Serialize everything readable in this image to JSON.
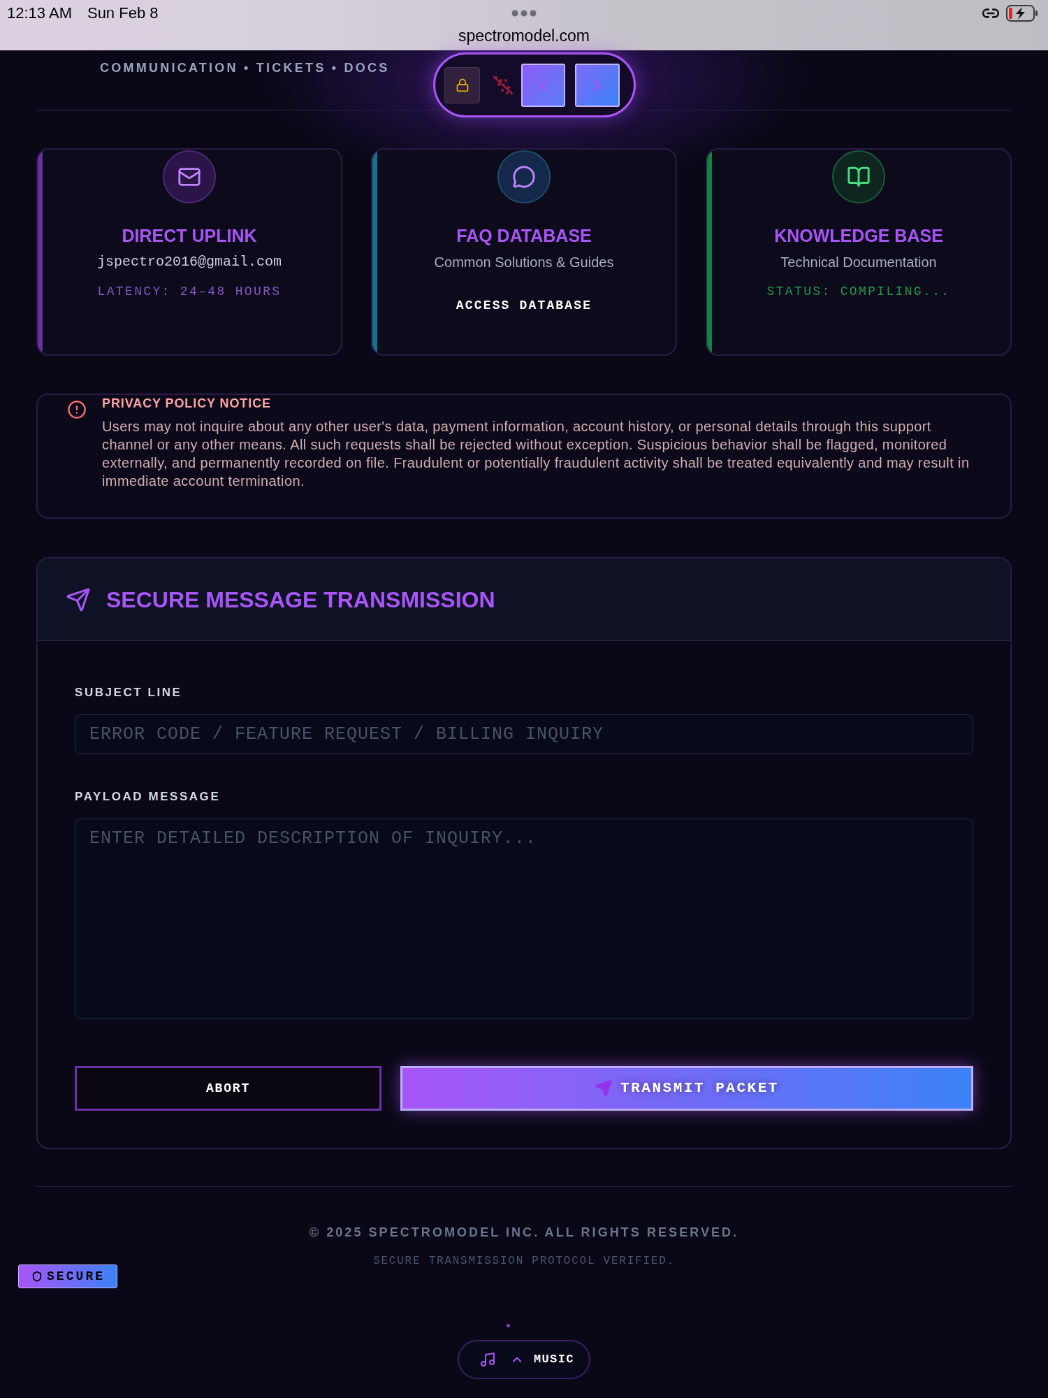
{
  "status_bar": {
    "time": "12:13 AM",
    "date": "Sun Feb 8",
    "url": "spectromodel.com"
  },
  "header": {
    "breadcrumb": "COMMUNICATION • TICKETS • DOCS"
  },
  "channels": [
    {
      "kind": "contact",
      "title": "DIRECT UPLINK",
      "subtitle": "jspectro2016@gmail.com",
      "detail": "LATENCY: 24–48 HOURS",
      "color": "#6b2fa0"
    },
    {
      "kind": "link",
      "title": "FAQ DATABASE",
      "subtitle": "Common Solutions & Guides",
      "detail": "ACCESS DATABASE",
      "color": "#0e7490"
    },
    {
      "kind": "status",
      "title": "KNOWLEDGE BASE",
      "subtitle": "Technical Documentation",
      "detail": "STATUS: COMPILING...",
      "color": "#15803d"
    }
  ],
  "notice": {
    "title": "PRIVACY POLICY NOTICE",
    "body": "Users may not inquire about any other user's data, payment information, account history, or personal details through this support channel or any other means. All such requests shall be rejected without exception. Suspicious behavior shall be flagged, monitored externally, and permanently recorded on file. Fraudulent or potentially fraudulent activity shall be treated equivalently and may result in immediate account termination."
  },
  "form": {
    "title": "SECURE MESSAGE TRANSMISSION",
    "fields": [
      {
        "kind": "line",
        "label": "SUBJECT LINE",
        "placeholder": "ERROR CODE / FEATURE REQUEST / BILLING INQUIRY"
      },
      {
        "kind": "area",
        "label": "PAYLOAD MESSAGE",
        "placeholder": "ENTER DETAILED DESCRIPTION OF INQUIRY..."
      }
    ],
    "buttons": [
      {
        "kind": "secondary",
        "label": "ABORT"
      },
      {
        "kind": "primary",
        "label": "TRANSMIT PACKET"
      }
    ]
  },
  "footer": {
    "copyright": "© 2025 SPECTROMODEL INC. ALL RIGHTS RESERVED.",
    "note": "SECURE TRANSMISSION PROTOCOL VERIFIED."
  },
  "badge": {
    "label": "SECURE"
  },
  "music": {
    "label": "MUSIC"
  }
}
